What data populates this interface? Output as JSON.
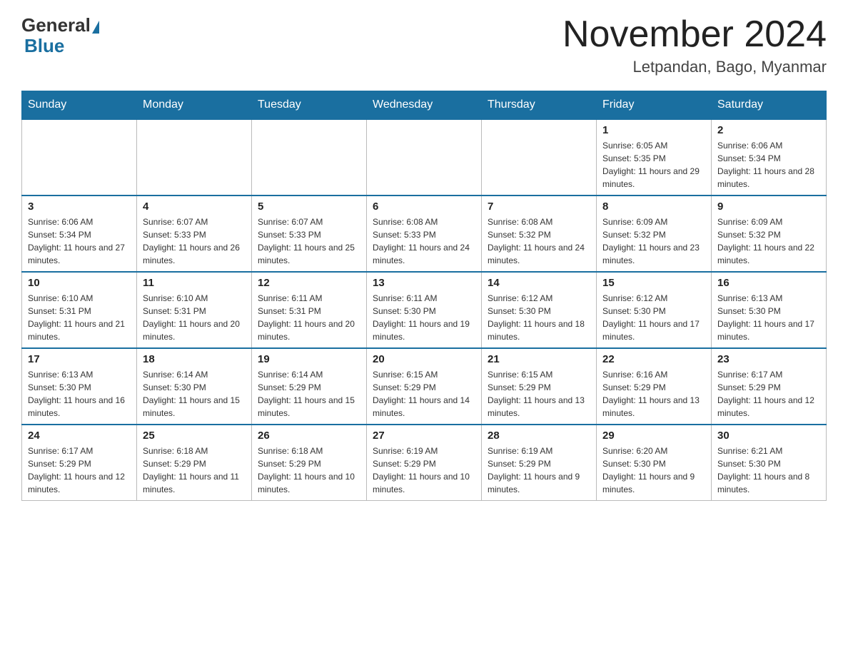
{
  "header": {
    "logo": {
      "general": "General",
      "blue": "Blue"
    },
    "title": "November 2024",
    "location": "Letpandan, Bago, Myanmar"
  },
  "calendar": {
    "days": [
      "Sunday",
      "Monday",
      "Tuesday",
      "Wednesday",
      "Thursday",
      "Friday",
      "Saturday"
    ],
    "weeks": [
      [
        {
          "day": "",
          "info": ""
        },
        {
          "day": "",
          "info": ""
        },
        {
          "day": "",
          "info": ""
        },
        {
          "day": "",
          "info": ""
        },
        {
          "day": "",
          "info": ""
        },
        {
          "day": "1",
          "info": "Sunrise: 6:05 AM\nSunset: 5:35 PM\nDaylight: 11 hours and 29 minutes."
        },
        {
          "day": "2",
          "info": "Sunrise: 6:06 AM\nSunset: 5:34 PM\nDaylight: 11 hours and 28 minutes."
        }
      ],
      [
        {
          "day": "3",
          "info": "Sunrise: 6:06 AM\nSunset: 5:34 PM\nDaylight: 11 hours and 27 minutes."
        },
        {
          "day": "4",
          "info": "Sunrise: 6:07 AM\nSunset: 5:33 PM\nDaylight: 11 hours and 26 minutes."
        },
        {
          "day": "5",
          "info": "Sunrise: 6:07 AM\nSunset: 5:33 PM\nDaylight: 11 hours and 25 minutes."
        },
        {
          "day": "6",
          "info": "Sunrise: 6:08 AM\nSunset: 5:33 PM\nDaylight: 11 hours and 24 minutes."
        },
        {
          "day": "7",
          "info": "Sunrise: 6:08 AM\nSunset: 5:32 PM\nDaylight: 11 hours and 24 minutes."
        },
        {
          "day": "8",
          "info": "Sunrise: 6:09 AM\nSunset: 5:32 PM\nDaylight: 11 hours and 23 minutes."
        },
        {
          "day": "9",
          "info": "Sunrise: 6:09 AM\nSunset: 5:32 PM\nDaylight: 11 hours and 22 minutes."
        }
      ],
      [
        {
          "day": "10",
          "info": "Sunrise: 6:10 AM\nSunset: 5:31 PM\nDaylight: 11 hours and 21 minutes."
        },
        {
          "day": "11",
          "info": "Sunrise: 6:10 AM\nSunset: 5:31 PM\nDaylight: 11 hours and 20 minutes."
        },
        {
          "day": "12",
          "info": "Sunrise: 6:11 AM\nSunset: 5:31 PM\nDaylight: 11 hours and 20 minutes."
        },
        {
          "day": "13",
          "info": "Sunrise: 6:11 AM\nSunset: 5:30 PM\nDaylight: 11 hours and 19 minutes."
        },
        {
          "day": "14",
          "info": "Sunrise: 6:12 AM\nSunset: 5:30 PM\nDaylight: 11 hours and 18 minutes."
        },
        {
          "day": "15",
          "info": "Sunrise: 6:12 AM\nSunset: 5:30 PM\nDaylight: 11 hours and 17 minutes."
        },
        {
          "day": "16",
          "info": "Sunrise: 6:13 AM\nSunset: 5:30 PM\nDaylight: 11 hours and 17 minutes."
        }
      ],
      [
        {
          "day": "17",
          "info": "Sunrise: 6:13 AM\nSunset: 5:30 PM\nDaylight: 11 hours and 16 minutes."
        },
        {
          "day": "18",
          "info": "Sunrise: 6:14 AM\nSunset: 5:30 PM\nDaylight: 11 hours and 15 minutes."
        },
        {
          "day": "19",
          "info": "Sunrise: 6:14 AM\nSunset: 5:29 PM\nDaylight: 11 hours and 15 minutes."
        },
        {
          "day": "20",
          "info": "Sunrise: 6:15 AM\nSunset: 5:29 PM\nDaylight: 11 hours and 14 minutes."
        },
        {
          "day": "21",
          "info": "Sunrise: 6:15 AM\nSunset: 5:29 PM\nDaylight: 11 hours and 13 minutes."
        },
        {
          "day": "22",
          "info": "Sunrise: 6:16 AM\nSunset: 5:29 PM\nDaylight: 11 hours and 13 minutes."
        },
        {
          "day": "23",
          "info": "Sunrise: 6:17 AM\nSunset: 5:29 PM\nDaylight: 11 hours and 12 minutes."
        }
      ],
      [
        {
          "day": "24",
          "info": "Sunrise: 6:17 AM\nSunset: 5:29 PM\nDaylight: 11 hours and 12 minutes."
        },
        {
          "day": "25",
          "info": "Sunrise: 6:18 AM\nSunset: 5:29 PM\nDaylight: 11 hours and 11 minutes."
        },
        {
          "day": "26",
          "info": "Sunrise: 6:18 AM\nSunset: 5:29 PM\nDaylight: 11 hours and 10 minutes."
        },
        {
          "day": "27",
          "info": "Sunrise: 6:19 AM\nSunset: 5:29 PM\nDaylight: 11 hours and 10 minutes."
        },
        {
          "day": "28",
          "info": "Sunrise: 6:19 AM\nSunset: 5:29 PM\nDaylight: 11 hours and 9 minutes."
        },
        {
          "day": "29",
          "info": "Sunrise: 6:20 AM\nSunset: 5:30 PM\nDaylight: 11 hours and 9 minutes."
        },
        {
          "day": "30",
          "info": "Sunrise: 6:21 AM\nSunset: 5:30 PM\nDaylight: 11 hours and 8 minutes."
        }
      ]
    ]
  }
}
